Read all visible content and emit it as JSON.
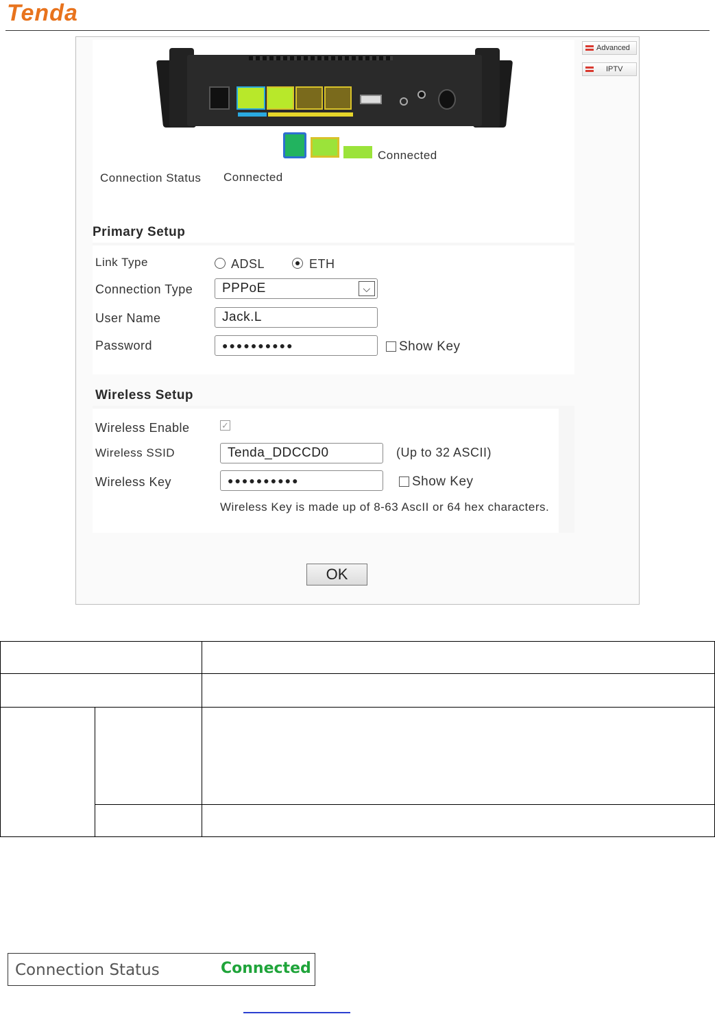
{
  "header": {
    "brand": "Tenda"
  },
  "router_ui": {
    "side_buttons": [
      "Advanced",
      "IPTV"
    ],
    "icons": {
      "phone_port": "phone-port-icon",
      "ethernet_port": "ethernet-port-icon",
      "link": "link-indicator-icon"
    },
    "legend_status": "Connected",
    "connection_status": {
      "label": "Connection Status",
      "value": "Connected"
    },
    "primary_setup": {
      "title": "Primary Setup",
      "link_type": {
        "label": "Link Type",
        "options": [
          "ADSL",
          "ETH"
        ],
        "selected": "ETH"
      },
      "connection_type": {
        "label": "Connection Type",
        "value": "PPPoE"
      },
      "user_name": {
        "label": "User Name",
        "value": "Jack.L"
      },
      "password": {
        "label": "Password",
        "value": "●●●●●●●●●●",
        "show_key": "Show Key"
      }
    },
    "wireless_setup": {
      "title": "Wireless Setup",
      "wireless_enable": {
        "label": "Wireless Enable",
        "checked": true
      },
      "ssid": {
        "label": "Wireless SSID",
        "value": "Tenda_DDCCD0",
        "hint": "(Up to 32 ASCII)"
      },
      "key": {
        "label": "Wireless Key",
        "value": "●●●●●●●●●●",
        "show_key": "Show Key"
      },
      "note": "Wireless Key is made up of 8-63 AscII or 64 hex characters."
    },
    "ok_label": "OK"
  },
  "status_box": {
    "label": "Connection Status",
    "value": "Connected",
    "value_color": "#1fa43a"
  }
}
